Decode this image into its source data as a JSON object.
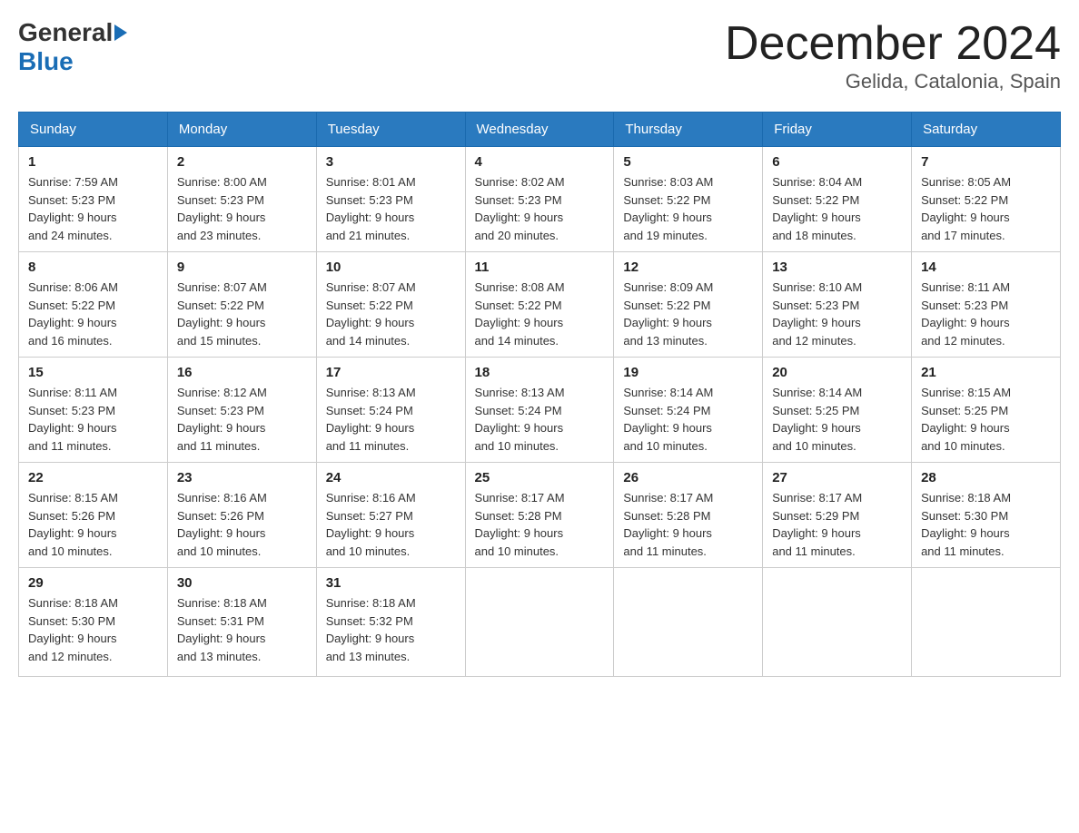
{
  "header": {
    "logo_general": "General",
    "logo_blue": "Blue",
    "title": "December 2024",
    "location": "Gelida, Catalonia, Spain"
  },
  "days_of_week": [
    "Sunday",
    "Monday",
    "Tuesday",
    "Wednesday",
    "Thursday",
    "Friday",
    "Saturday"
  ],
  "weeks": [
    [
      {
        "day": "1",
        "sunrise": "7:59 AM",
        "sunset": "5:23 PM",
        "daylight": "9 hours and 24 minutes."
      },
      {
        "day": "2",
        "sunrise": "8:00 AM",
        "sunset": "5:23 PM",
        "daylight": "9 hours and 23 minutes."
      },
      {
        "day": "3",
        "sunrise": "8:01 AM",
        "sunset": "5:23 PM",
        "daylight": "9 hours and 21 minutes."
      },
      {
        "day": "4",
        "sunrise": "8:02 AM",
        "sunset": "5:23 PM",
        "daylight": "9 hours and 20 minutes."
      },
      {
        "day": "5",
        "sunrise": "8:03 AM",
        "sunset": "5:22 PM",
        "daylight": "9 hours and 19 minutes."
      },
      {
        "day": "6",
        "sunrise": "8:04 AM",
        "sunset": "5:22 PM",
        "daylight": "9 hours and 18 minutes."
      },
      {
        "day": "7",
        "sunrise": "8:05 AM",
        "sunset": "5:22 PM",
        "daylight": "9 hours and 17 minutes."
      }
    ],
    [
      {
        "day": "8",
        "sunrise": "8:06 AM",
        "sunset": "5:22 PM",
        "daylight": "9 hours and 16 minutes."
      },
      {
        "day": "9",
        "sunrise": "8:07 AM",
        "sunset": "5:22 PM",
        "daylight": "9 hours and 15 minutes."
      },
      {
        "day": "10",
        "sunrise": "8:07 AM",
        "sunset": "5:22 PM",
        "daylight": "9 hours and 14 minutes."
      },
      {
        "day": "11",
        "sunrise": "8:08 AM",
        "sunset": "5:22 PM",
        "daylight": "9 hours and 14 minutes."
      },
      {
        "day": "12",
        "sunrise": "8:09 AM",
        "sunset": "5:22 PM",
        "daylight": "9 hours and 13 minutes."
      },
      {
        "day": "13",
        "sunrise": "8:10 AM",
        "sunset": "5:23 PM",
        "daylight": "9 hours and 12 minutes."
      },
      {
        "day": "14",
        "sunrise": "8:11 AM",
        "sunset": "5:23 PM",
        "daylight": "9 hours and 12 minutes."
      }
    ],
    [
      {
        "day": "15",
        "sunrise": "8:11 AM",
        "sunset": "5:23 PM",
        "daylight": "9 hours and 11 minutes."
      },
      {
        "day": "16",
        "sunrise": "8:12 AM",
        "sunset": "5:23 PM",
        "daylight": "9 hours and 11 minutes."
      },
      {
        "day": "17",
        "sunrise": "8:13 AM",
        "sunset": "5:24 PM",
        "daylight": "9 hours and 11 minutes."
      },
      {
        "day": "18",
        "sunrise": "8:13 AM",
        "sunset": "5:24 PM",
        "daylight": "9 hours and 10 minutes."
      },
      {
        "day": "19",
        "sunrise": "8:14 AM",
        "sunset": "5:24 PM",
        "daylight": "9 hours and 10 minutes."
      },
      {
        "day": "20",
        "sunrise": "8:14 AM",
        "sunset": "5:25 PM",
        "daylight": "9 hours and 10 minutes."
      },
      {
        "day": "21",
        "sunrise": "8:15 AM",
        "sunset": "5:25 PM",
        "daylight": "9 hours and 10 minutes."
      }
    ],
    [
      {
        "day": "22",
        "sunrise": "8:15 AM",
        "sunset": "5:26 PM",
        "daylight": "9 hours and 10 minutes."
      },
      {
        "day": "23",
        "sunrise": "8:16 AM",
        "sunset": "5:26 PM",
        "daylight": "9 hours and 10 minutes."
      },
      {
        "day": "24",
        "sunrise": "8:16 AM",
        "sunset": "5:27 PM",
        "daylight": "9 hours and 10 minutes."
      },
      {
        "day": "25",
        "sunrise": "8:17 AM",
        "sunset": "5:28 PM",
        "daylight": "9 hours and 10 minutes."
      },
      {
        "day": "26",
        "sunrise": "8:17 AM",
        "sunset": "5:28 PM",
        "daylight": "9 hours and 11 minutes."
      },
      {
        "day": "27",
        "sunrise": "8:17 AM",
        "sunset": "5:29 PM",
        "daylight": "9 hours and 11 minutes."
      },
      {
        "day": "28",
        "sunrise": "8:18 AM",
        "sunset": "5:30 PM",
        "daylight": "9 hours and 11 minutes."
      }
    ],
    [
      {
        "day": "29",
        "sunrise": "8:18 AM",
        "sunset": "5:30 PM",
        "daylight": "9 hours and 12 minutes."
      },
      {
        "day": "30",
        "sunrise": "8:18 AM",
        "sunset": "5:31 PM",
        "daylight": "9 hours and 13 minutes."
      },
      {
        "day": "31",
        "sunrise": "8:18 AM",
        "sunset": "5:32 PM",
        "daylight": "9 hours and 13 minutes."
      },
      null,
      null,
      null,
      null
    ]
  ]
}
